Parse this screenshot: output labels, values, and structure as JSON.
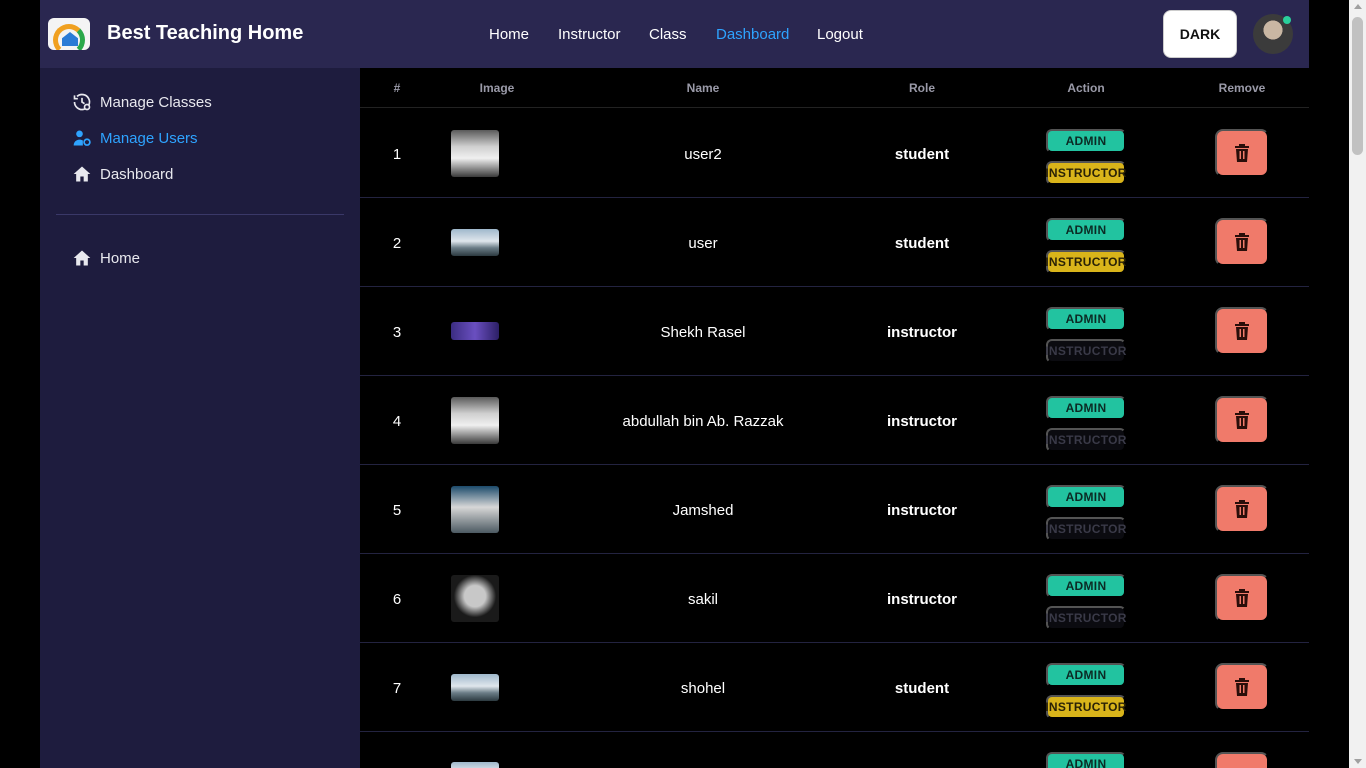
{
  "navbar": {
    "brand": "Best Teaching Home",
    "links": [
      {
        "label": "Home",
        "active": false
      },
      {
        "label": "Instructor",
        "active": false
      },
      {
        "label": "Class",
        "active": false
      },
      {
        "label": "Dashboard",
        "active": true
      },
      {
        "label": "Logout",
        "active": false
      }
    ],
    "theme_button": "DARK",
    "icons": {
      "logo": "school-logo-icon",
      "avatar": "user-avatar",
      "status": "online-dot-icon"
    }
  },
  "sidebar": {
    "items": [
      {
        "label": "Manage Classes",
        "icon": "clock-gear-icon",
        "active": false
      },
      {
        "label": "Manage Users",
        "icon": "user-gear-icon",
        "active": true
      },
      {
        "label": "Dashboard",
        "icon": "home-icon",
        "active": false
      }
    ],
    "bottom_items": [
      {
        "label": "Home",
        "icon": "home-icon",
        "active": false
      }
    ]
  },
  "table": {
    "headers": [
      "#",
      "Image",
      "Name",
      "Role",
      "Action",
      "Remove"
    ],
    "admin_label": "ADMIN",
    "instructor_label": "INSTRUCTOR",
    "rows": [
      {
        "index": "1",
        "name": "user2",
        "role": "student",
        "instructor_enabled": true,
        "image": "portrait-photo"
      },
      {
        "index": "2",
        "name": "user",
        "role": "student",
        "instructor_enabled": true,
        "image": "landscape-photo"
      },
      {
        "index": "3",
        "name": "Shekh Rasel",
        "role": "instructor",
        "instructor_enabled": false,
        "image": "banner-photo"
      },
      {
        "index": "4",
        "name": "abdullah bin Ab. Razzak",
        "role": "instructor",
        "instructor_enabled": false,
        "image": "portrait-photo"
      },
      {
        "index": "5",
        "name": "Jamshed",
        "role": "instructor",
        "instructor_enabled": false,
        "image": "portrait-photo"
      },
      {
        "index": "6",
        "name": "sakil",
        "role": "instructor",
        "instructor_enabled": false,
        "image": "bw-portrait-photo"
      },
      {
        "index": "7",
        "name": "shohel",
        "role": "student",
        "instructor_enabled": true,
        "image": "landscape-photo"
      }
    ],
    "partial_row": {
      "admin_label": "ADMIN"
    },
    "icons": {
      "delete": "trash-icon"
    }
  },
  "colors": {
    "navbar_bg": "#2a2750",
    "sidebar_bg": "#1e1c3e",
    "accent": "#2ea3ff",
    "admin": "#22c3a0",
    "instructor": "#d9b41a",
    "delete": "#f07a6a"
  }
}
